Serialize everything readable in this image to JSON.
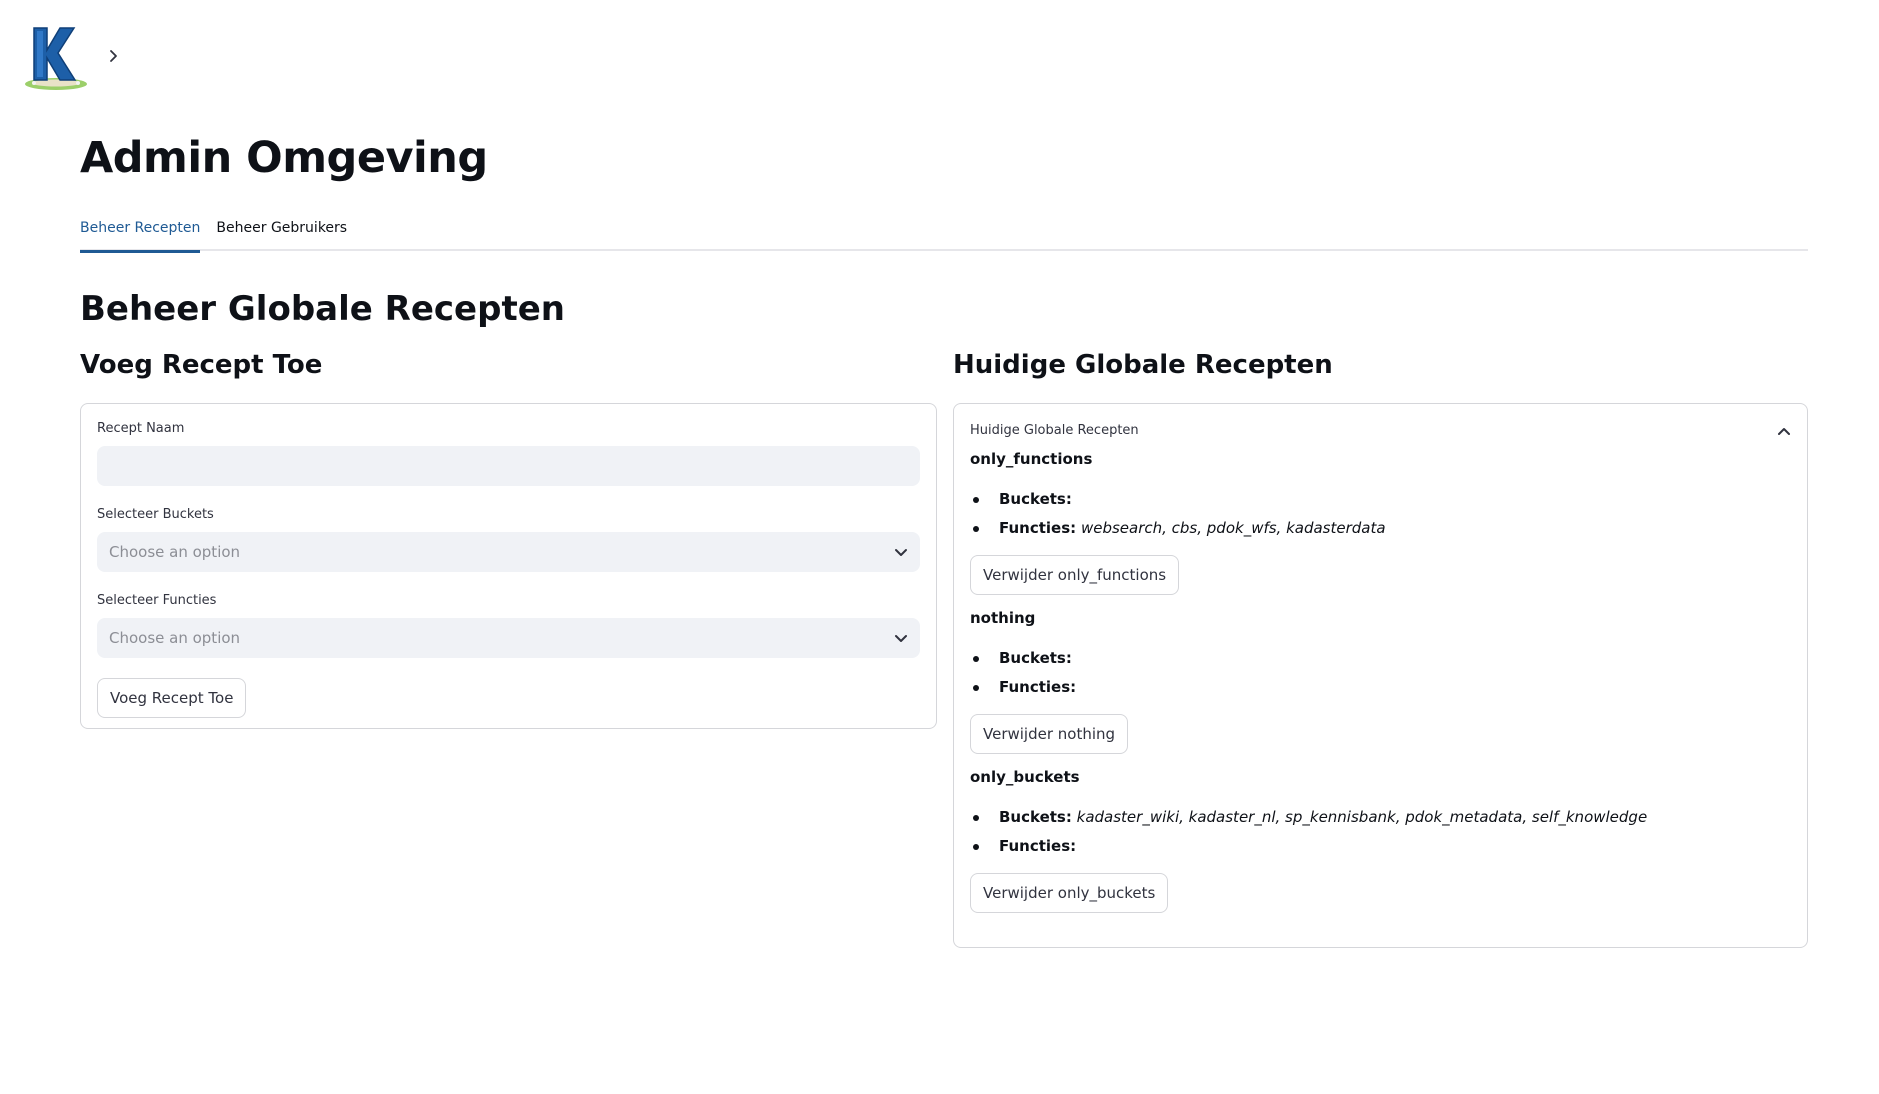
{
  "app": {
    "logo_letter": "K",
    "title": "Admin Omgeving"
  },
  "tabs": [
    {
      "label": "Beheer Recepten",
      "active": true
    },
    {
      "label": "Beheer Gebruikers",
      "active": false
    }
  ],
  "section_title": "Beheer Globale Recepten",
  "add_recipe": {
    "title": "Voeg Recept Toe",
    "name_label": "Recept Naam",
    "name_value": "",
    "buckets_label": "Selecteer Buckets",
    "buckets_placeholder": "Choose an option",
    "functions_label": "Selecteer Functies",
    "functions_placeholder": "Choose an option",
    "submit_label": "Voeg Recept Toe"
  },
  "current_recipes": {
    "title": "Huidige Globale Recepten",
    "expander_label": "Huidige Globale Recepten",
    "buckets_key": "Buckets:",
    "functions_key": "Functies:",
    "recipes": [
      {
        "name": "only_functions",
        "buckets": "",
        "functions": "websearch, cbs, pdok_wfs, kadasterdata",
        "delete_label": "Verwijder only_functions"
      },
      {
        "name": "nothing",
        "buckets": "",
        "functions": "",
        "delete_label": "Verwijder nothing"
      },
      {
        "name": "only_buckets",
        "buckets": "kadaster_wiki, kadaster_nl, sp_kennisbank, pdok_metadata, self_knowledge",
        "functions": "",
        "delete_label": "Verwijder only_buckets"
      }
    ]
  },
  "colors": {
    "accent": "#1f5a94",
    "input_bg": "#f0f2f6",
    "border": "#d5d6da",
    "text": "#0e1117"
  }
}
